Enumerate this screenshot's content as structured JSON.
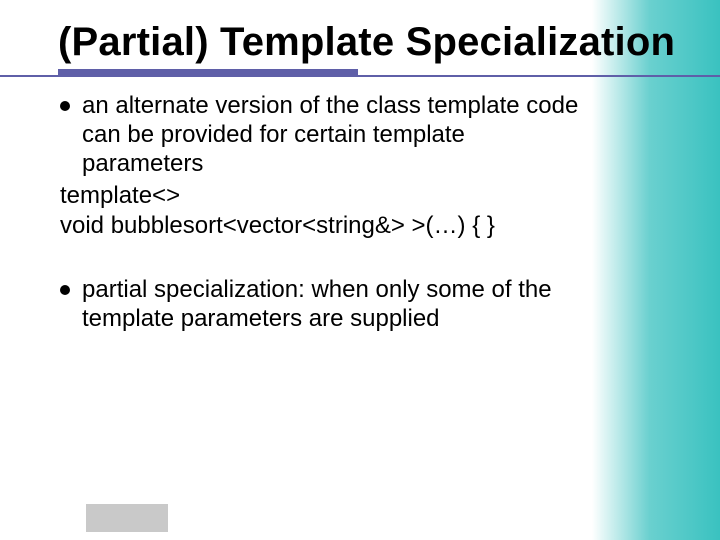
{
  "title": "(Partial) Template Specialization",
  "bullets": [
    {
      "text": "an alternate version of the class template code can be provided for certain template parameters",
      "code": [
        "template<>",
        "void bubblesort<vector<string&> >(…) { }"
      ]
    },
    {
      "text": "partial specialization: when only some of the template parameters are supplied",
      "code": []
    }
  ]
}
